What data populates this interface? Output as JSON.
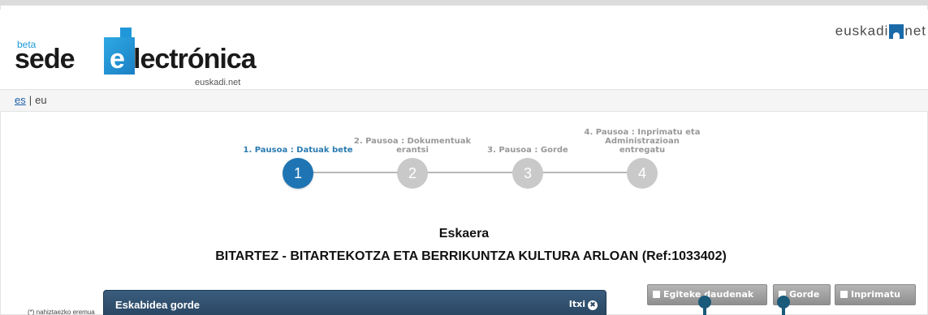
{
  "header": {
    "logo": {
      "beta": "beta",
      "sede": "sede",
      "e": "e",
      "electronica": "lectrónica",
      "domain": "euskadi.net"
    },
    "brand_right": {
      "left": "euskadi",
      "right": "net"
    }
  },
  "lang": {
    "es": "es",
    "separator": "|",
    "eu": "eu"
  },
  "steps": [
    {
      "label": "1. Pausoa : Datuak bete",
      "number": "1",
      "active": true
    },
    {
      "label": "2. Pausoa : Dokumentuak erantsi",
      "number": "2",
      "active": false
    },
    {
      "label": "3. Pausoa : Gorde",
      "number": "3",
      "active": false
    },
    {
      "label": "4. Pausoa : Inprimatu eta Administrazioan entregatu",
      "number": "4",
      "active": false
    }
  ],
  "content": {
    "title": "Eskaera",
    "subtitle": "BITARTEZ - BITARTEKOTZA ETA BERRIKUNTZA KULTURA ARLOAN (Ref:1033402)",
    "note": "(*) nahiztaezko eremua"
  },
  "actions": {
    "egiteke": "Egiteke daudenak",
    "gorde": "Gorde",
    "inprimatu": "Inprimatu"
  },
  "modal": {
    "title": "Eskabidea gorde",
    "close_label": "Itxi",
    "close_glyph": "✖"
  },
  "colors": {
    "accent": "#1f75b4",
    "step_inactive": "#c9c9c9",
    "modal_header": "#27445f",
    "button_gray": "#9e9e9e"
  }
}
